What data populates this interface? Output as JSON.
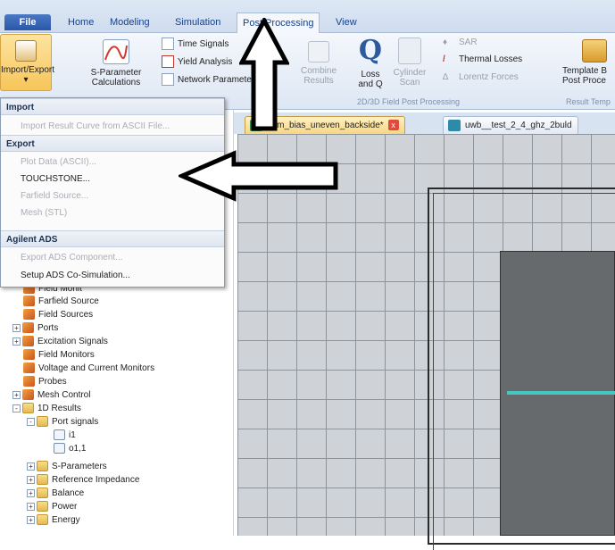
{
  "ribbon_tabs": {
    "file": "File",
    "home": "Home",
    "modeling": "Modeling",
    "simulation": "Simulation",
    "post_processing": "Post Processing",
    "view": "View"
  },
  "ribbon": {
    "import_export": "Import/Export",
    "sparam_line1": "S-Parameter",
    "sparam_line2": "Calculations",
    "time_signals": "Time Signals",
    "yield_analysis": "Yield Analysis",
    "network_parameters": "Network Parameters",
    "combine_line1": "Combine",
    "combine_line2": "Results",
    "loss_line1": "Loss",
    "loss_line2": "and Q",
    "cylinder_line1": "Cylinder",
    "cylinder_line2": "Scan",
    "sar": "SAR",
    "thermal_losses": "Thermal Losses",
    "lorentz_forces": "Lorentz Forces",
    "group_2d3d": "2D/3D Field Post Processing",
    "template_line1": "Template B",
    "template_line2": "Post Proce",
    "group_result_templates": "Result Temp"
  },
  "document_tabs": {
    "tab1": "ohm_bias_uneven_backside*",
    "tab2": "uwb__test_2_4_ghz_2buld",
    "close_glyph": "x"
  },
  "menu": {
    "import_header": "Import",
    "import_ascii": "Import Result Curve from ASCII File...",
    "export_header": "Export",
    "plot_data": "Plot Data (ASCII)...",
    "touchstone": "TOUCHSTONE...",
    "farfield_source": "Farfield Source...",
    "mesh_stl": "Mesh (STL)",
    "agilent_header": "Agilent ADS",
    "export_ads": "Export ADS Component...",
    "setup_ads": "Setup ADS Co-Simulation..."
  },
  "tree": {
    "partial": "Field Monit",
    "farfield_source": "Farfield Source",
    "field_sources": "Field Sources",
    "ports": "Ports",
    "excitation_signals": "Excitation Signals",
    "field_monitors": "Field Monitors",
    "voltage_current_monitors": "Voltage and Current Monitors",
    "probes": "Probes",
    "mesh_control": "Mesh Control",
    "results_1d": "1D Results",
    "port_signals": "Port signals",
    "i1": "i1",
    "o11": "o1,1",
    "s_parameters": "S-Parameters",
    "reference_impedance": "Reference Impedance",
    "balance": "Balance",
    "power": "Power",
    "energy": "Energy",
    "expand_plus": "+",
    "expand_minus": "-"
  },
  "dropdown_caret": "▾"
}
